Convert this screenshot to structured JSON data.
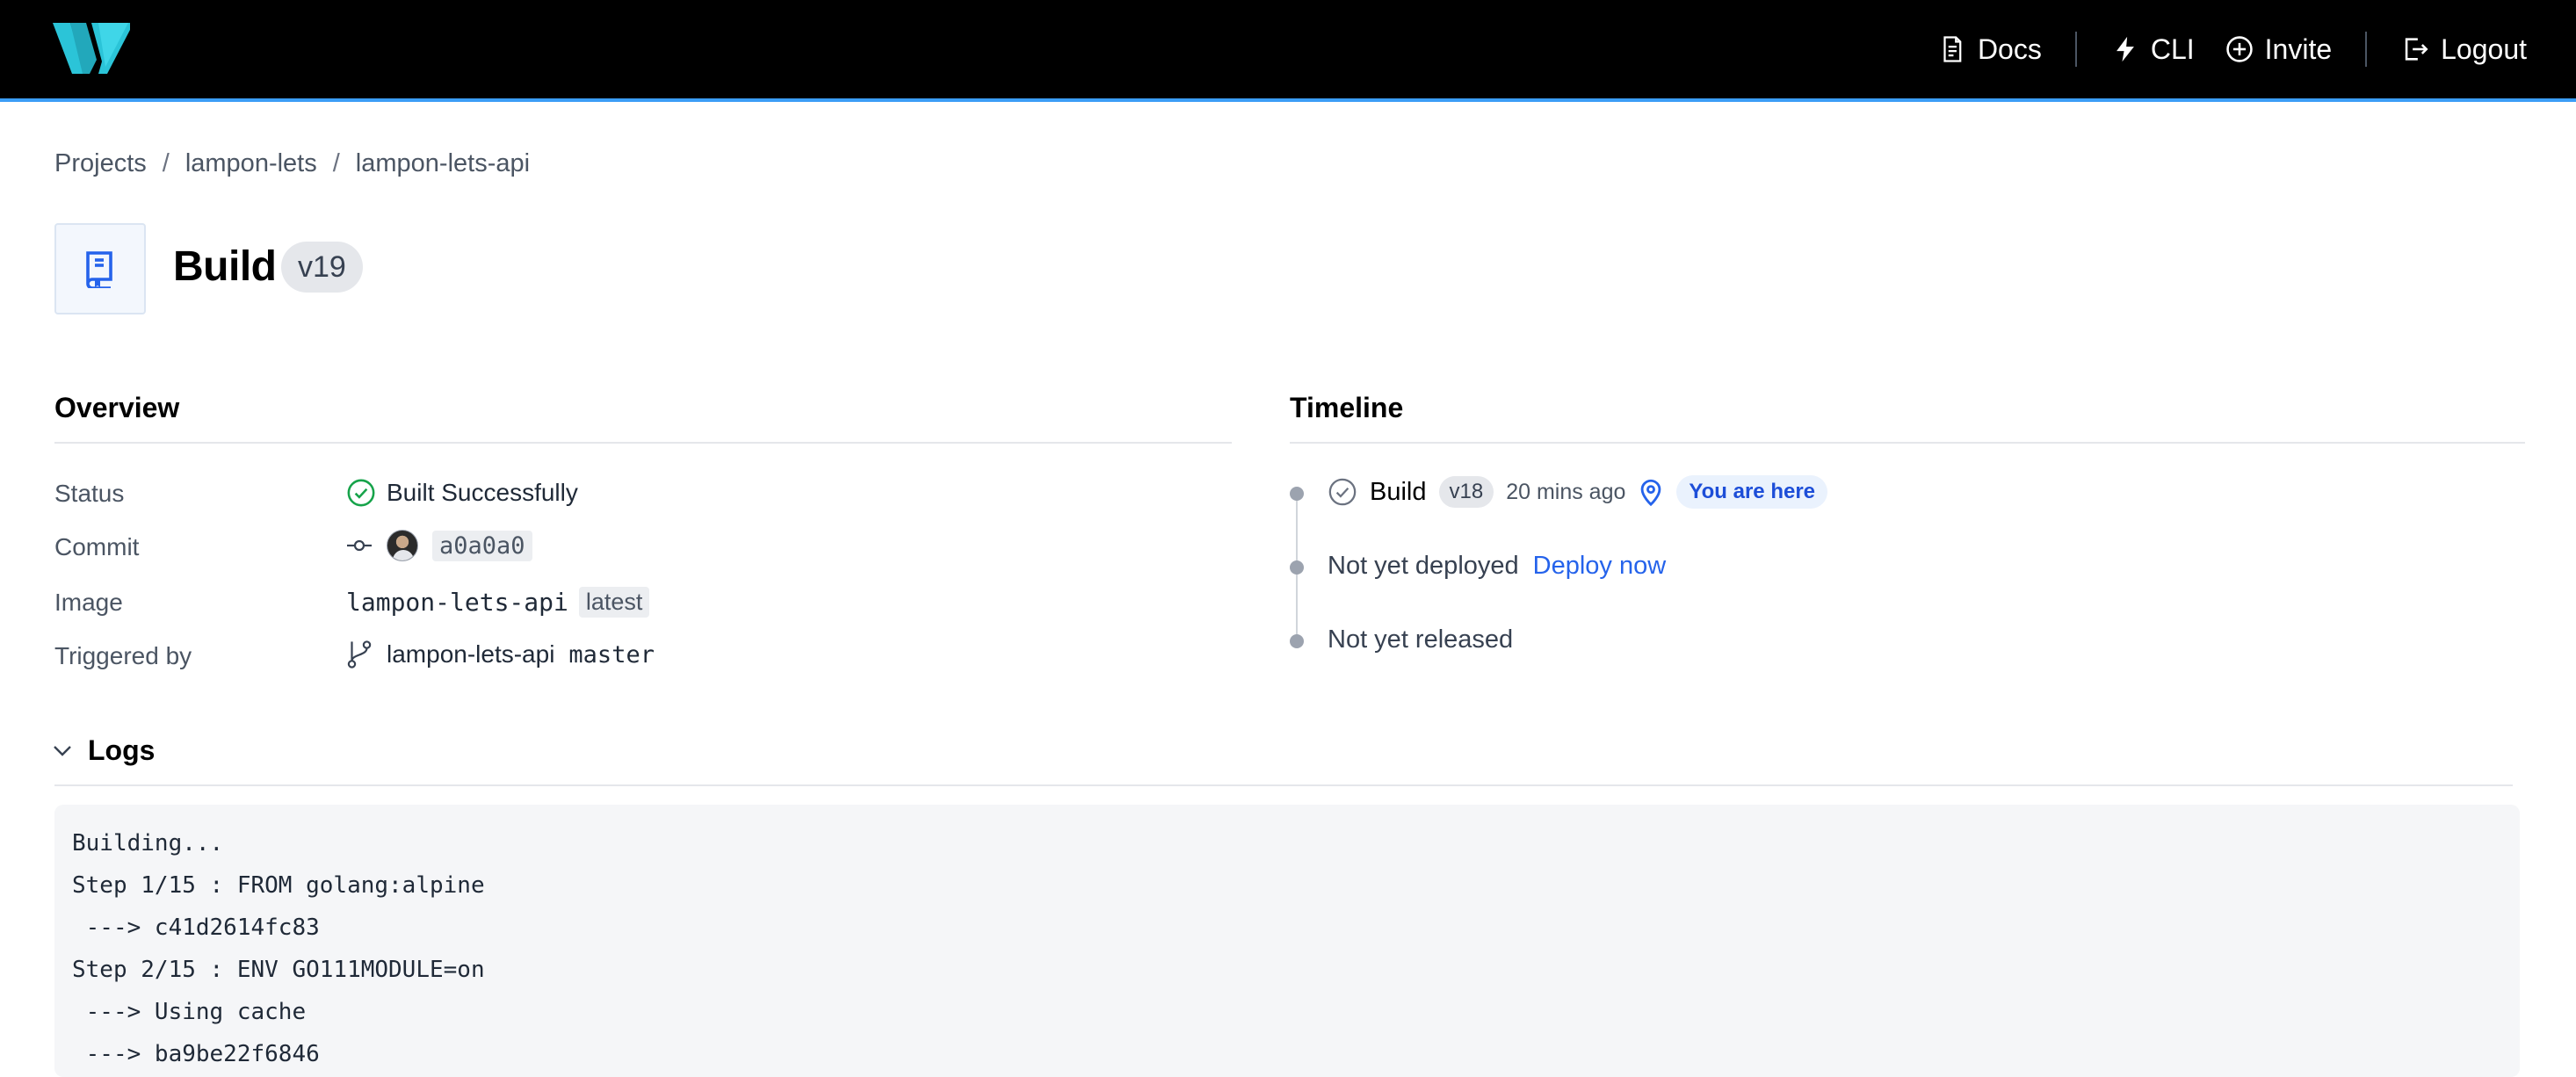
{
  "nav": {
    "docs": "Docs",
    "cli": "CLI",
    "invite": "Invite",
    "logout": "Logout"
  },
  "breadcrumb": [
    "Projects",
    "lampon-lets",
    "lampon-lets-api"
  ],
  "title": {
    "text": "Build",
    "version": "v19"
  },
  "overview": {
    "heading": "Overview",
    "status_label": "Status",
    "status_value": "Built Successfully",
    "commit_label": "Commit",
    "commit_hash": "a0a0a0",
    "image_label": "Image",
    "image_name": "lampon-lets-api",
    "image_tag": "latest",
    "triggered_label": "Triggered by",
    "triggered_repo": "lampon-lets-api",
    "triggered_branch": "master"
  },
  "timeline": {
    "heading": "Timeline",
    "build_label": "Build",
    "build_version": "v18",
    "build_time": "20 mins ago",
    "here_label": "You are here",
    "deploy_status": "Not yet deployed",
    "deploy_action": "Deploy now",
    "release_status": "Not yet released"
  },
  "logs": {
    "heading": "Logs",
    "lines": [
      "Building...",
      "Step 1/15 : FROM golang:alpine",
      " ---> c41d2614fc83",
      "Step 2/15 : ENV GO111MODULE=on",
      " ---> Using cache",
      " ---> ba9be22f6846"
    ]
  },
  "colors": {
    "accent": "#3b9df6",
    "logo": "#2bc4d8",
    "success": "#16a34a",
    "link": "#2563eb"
  },
  "icons": {
    "docs": "document-icon",
    "cli": "bolt-icon",
    "invite": "plus-circle-icon",
    "logout": "logout-icon",
    "title": "book-icon",
    "status": "check-circle-icon",
    "commit": "git-commit-icon",
    "triggered": "git-branch-icon",
    "location": "map-pin-icon",
    "logs": "chevron-down-icon"
  }
}
